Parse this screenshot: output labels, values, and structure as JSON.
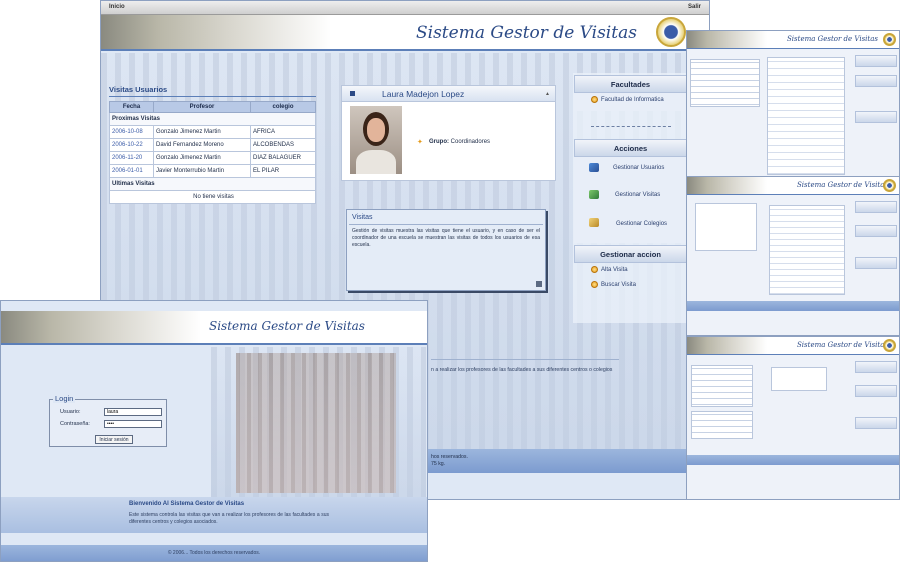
{
  "main_window": {
    "topbar": {
      "left_link": "Inicio",
      "right_link": "Salir"
    },
    "banner_title": "Sistema Gestor de Visitas",
    "visits": {
      "heading": "Visitas Usuarios",
      "columns": [
        "Fecha",
        "Profesor",
        "colegio"
      ],
      "upcoming_label": "Proximas Visitas",
      "rows": [
        [
          "2006-10-08",
          "Gonzalo Jimenez Martin",
          "AFRICA"
        ],
        [
          "2006-10-22",
          "David Fernandez Moreno",
          "ALCOBENDAS"
        ],
        [
          "2006-11-20",
          "Gonzalo Jimenez Martin",
          "DIAZ BALAGUER"
        ],
        [
          "2006-01-01",
          "Javier Monterrubio Martin",
          "EL PILAR"
        ]
      ],
      "past_label": "Ultimas Visitas",
      "empty_text": "No tiene visitas"
    },
    "profile": {
      "name": "Laura Madejon Lopez",
      "group_label": "Grupo:",
      "group_value": "Coordinadores"
    },
    "info_panel": {
      "title": "Visitas",
      "text": "Gestión de visitas muestra las visitas que tiene el usuario, y en caso de ser el coordinador de una escuela se muestran las visitas de todos los usuarios de esa escuela."
    },
    "sidebar": {
      "facultades_title": "Facultades",
      "facultades_link": "Facultad de Informatica",
      "acciones_title": "Acciones",
      "acciones": [
        "Gestionar Usuarios",
        "Gestionar Visitas",
        "Gestionar Colegios"
      ],
      "gestionar_accion_title": "Gestionar accion",
      "gestionar_accion": [
        "Alta Visita",
        "Buscar Visita"
      ]
    },
    "partial_text": "n a realizar los profesores de las facultades a sus diferentes centros o colegios",
    "partial_footer": [
      "hos reservados.",
      "75 kg."
    ]
  },
  "login_window": {
    "banner_title": "Sistema Gestor de Visitas",
    "login": {
      "legend": "Login",
      "user_label": "Usuario:",
      "user_value": "laura",
      "password_label": "Contraseña:",
      "password_value": "••••",
      "button": "Iniciar sesión"
    },
    "welcome_title": "Bienvenido Al Sistema Gestor de Visitas",
    "welcome_text": "Este sistema controla las visitas que van a realizar los profesores de las facultades a sus diferentes centros y colegios asociados.",
    "footer": "© 2006... Todos los derechos reservados."
  },
  "thumbnails": [
    {
      "title": "Sistema Gestor de Visitas"
    },
    {
      "title": "Sistema Gestor de Visitas"
    },
    {
      "title": "Sistema Gestor de Visitas"
    }
  ],
  "colors": {
    "accent": "#2b4a86",
    "bar": "#7c9bcf",
    "panel": "#dfe8f5",
    "bullet": "#e59a19"
  }
}
